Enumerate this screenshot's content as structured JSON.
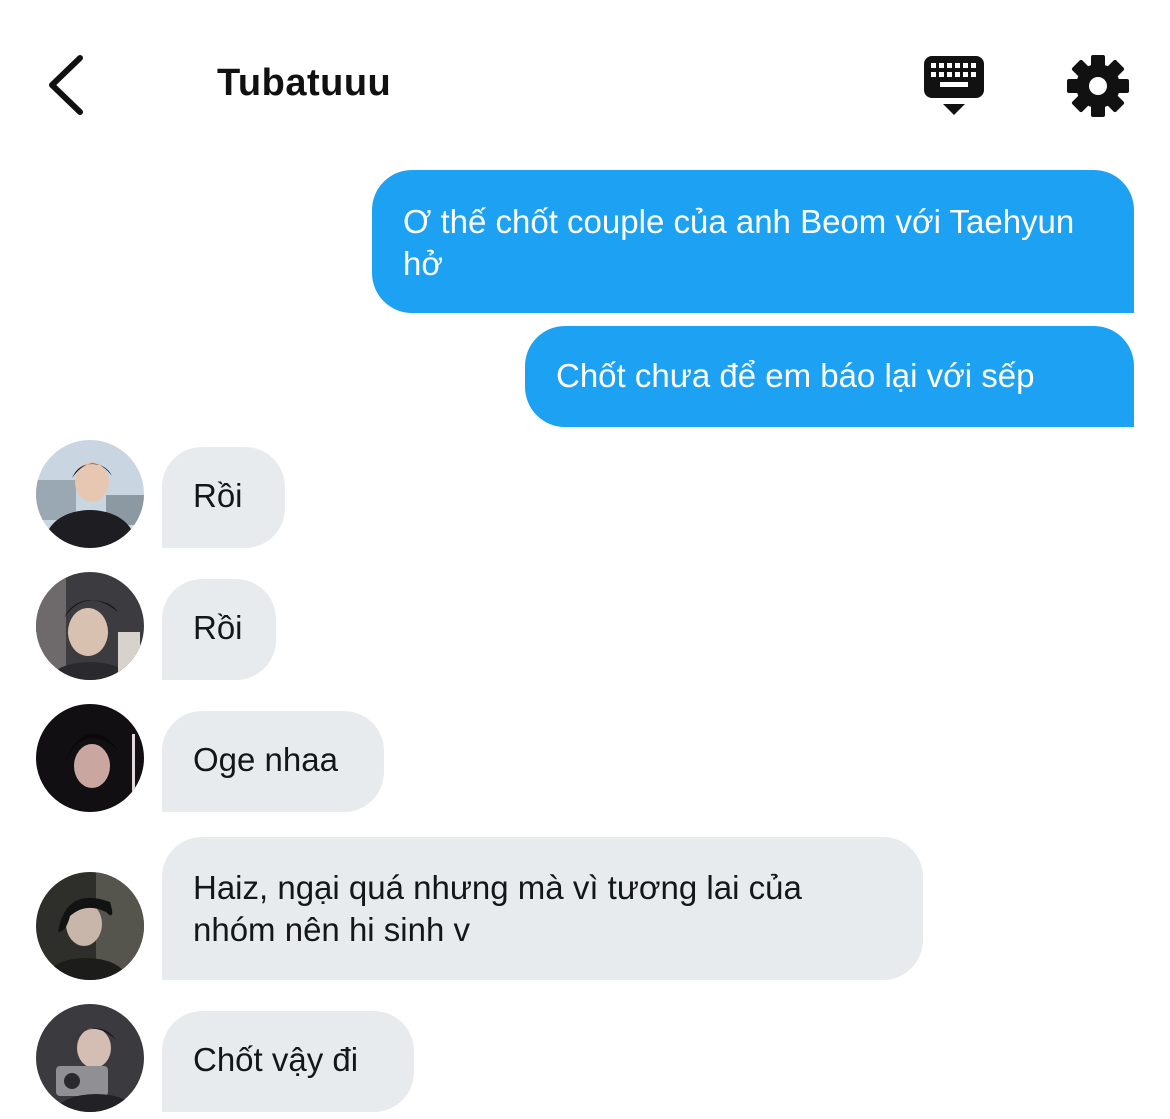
{
  "header": {
    "title": "Tubatuuu",
    "back_icon": "chevron-left-icon",
    "keyboard_icon": "keyboard-icon",
    "settings_icon": "gear-icon"
  },
  "colors": {
    "sent_bubble": "#1da1f2",
    "received_bubble": "#e7ebee",
    "text_dark": "#14171a"
  },
  "messages": [
    {
      "from": "me",
      "text": "Ơ thế chốt couple của anh Beom với Taehyun hở"
    },
    {
      "from": "me",
      "text": "Chốt chưa để em báo lại với sếp"
    },
    {
      "from": "member-1",
      "text": "Rồi"
    },
    {
      "from": "member-2",
      "text": "Rồi"
    },
    {
      "from": "member-3",
      "text": "Oge nhaa"
    },
    {
      "from": "member-4",
      "text": "Haiz, ngại quá nhưng mà vì tương lai của nhóm nên hi sinh v"
    },
    {
      "from": "member-5",
      "text": "Chốt vậy đi"
    }
  ]
}
